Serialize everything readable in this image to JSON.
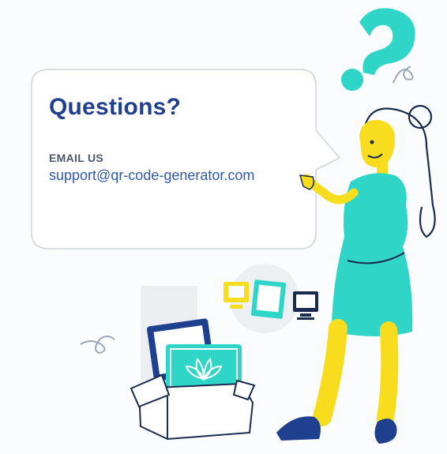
{
  "contact": {
    "title": "Questions?",
    "email_label": "EMAIL US",
    "email": "support@qr-code-generator.com"
  },
  "colors": {
    "title": "#1f3f8f",
    "link": "#2f5aa8",
    "accent_teal": "#2fd6c8",
    "accent_yellow": "#f8dd1e",
    "navy": "#1b2a4f"
  },
  "icons": [
    "question-mark-icon",
    "flower-icon",
    "monitor-icon",
    "picture-frame-icon"
  ]
}
